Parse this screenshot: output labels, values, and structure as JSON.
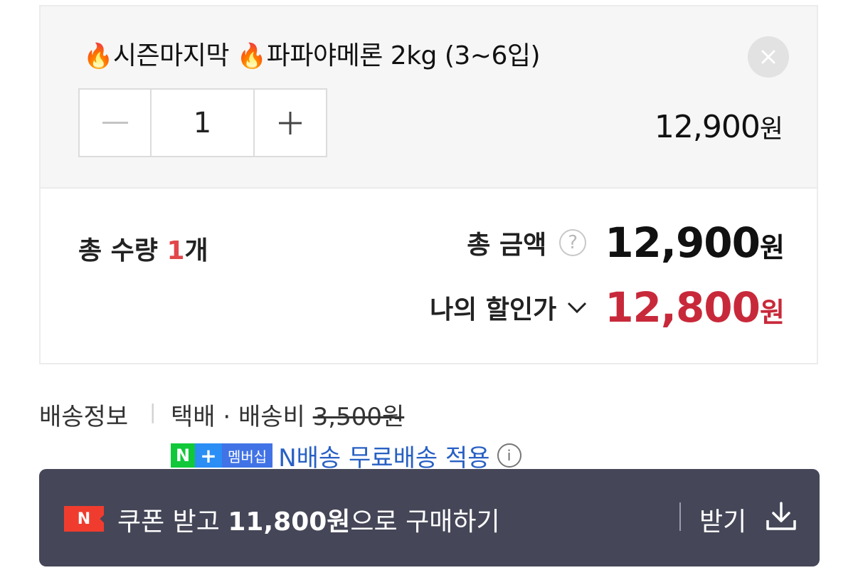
{
  "product": {
    "fire_emoji": "🔥",
    "title_part1": "시즌마지막",
    "title_part2": "파파야메론 2kg (3~6입)",
    "remove_icon": "close-icon",
    "quantity": "1",
    "minus": "—",
    "plus": "+",
    "price": "12,900",
    "currency": "원"
  },
  "summary": {
    "total_qty_label": "총 수량",
    "total_qty_value": "1",
    "total_qty_unit": "개",
    "total_amount_label": "총 금액",
    "help_glyph": "?",
    "total_amount": "12,900",
    "currency": "원",
    "discount_label": "나의 할인가",
    "discount_amount": "12,800"
  },
  "shipping": {
    "label": "배송정보",
    "separator": "|",
    "method": "택배 · 배송비 ",
    "fee": "3,500원",
    "badge_n": "N",
    "badge_plus": "+",
    "badge_member": "멤버십",
    "membership_text": "N배송 무료배송 적용",
    "info_glyph": "i"
  },
  "coupon": {
    "badge": "N",
    "prefix": "쿠폰 받고 ",
    "amount": "11,800원",
    "suffix": "으로 구매하기",
    "receive_label": "받기"
  },
  "colors": {
    "discount": "#c8293a",
    "qty_highlight": "#e2474a",
    "coupon_bar": "#454758",
    "naver_green": "#10c83a",
    "membership_blue": "#2860c4"
  }
}
